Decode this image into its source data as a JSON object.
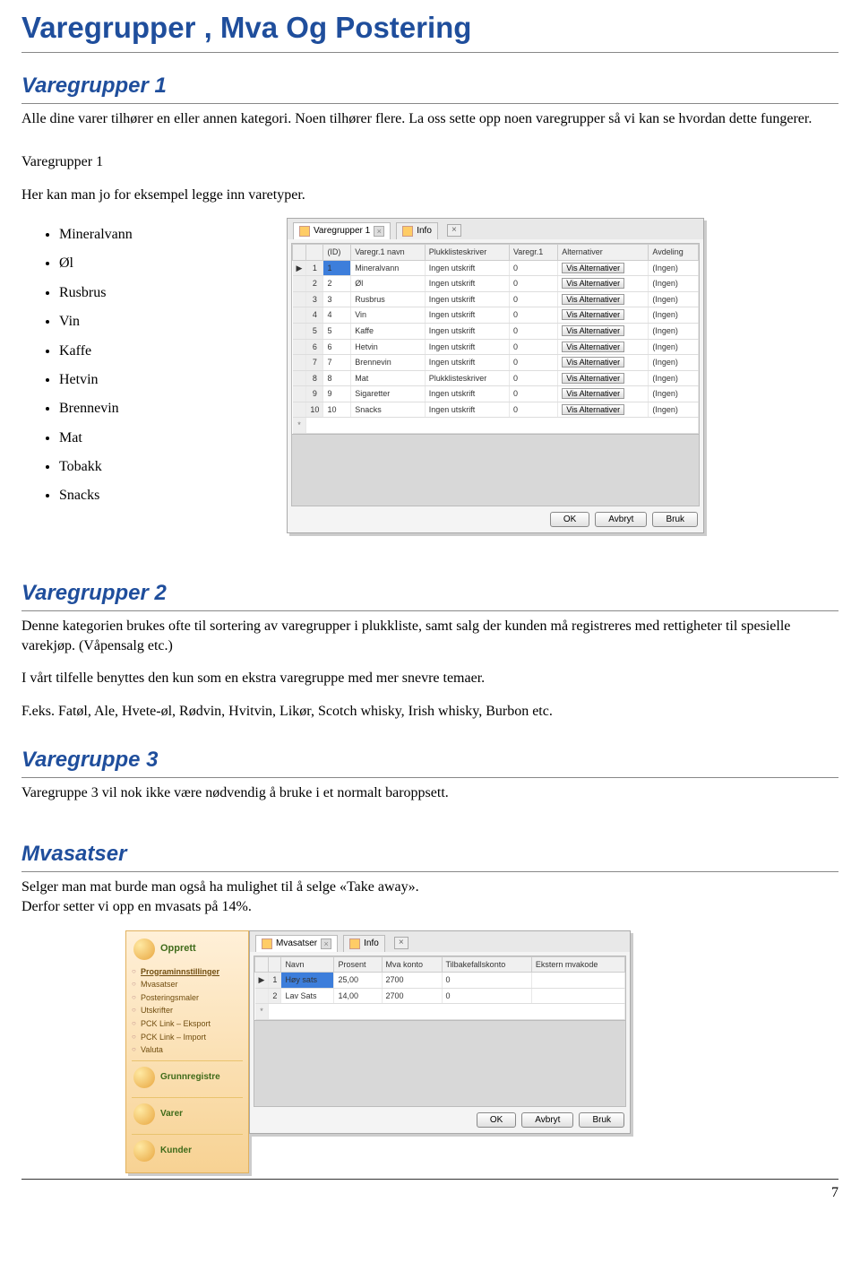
{
  "page_title": "Varegrupper , Mva Og Postering",
  "varegrupper1": {
    "heading": "Varegrupper 1",
    "intro": "Alle dine varer tilhører en eller annen kategori. Noen tilhører flere. La oss sette opp noen varegrupper så vi kan se hvordan dette fungerer.",
    "sub_label": "Varegrupper 1",
    "sub_text": "Her kan man jo for eksempel legge inn varetyper.",
    "bullets": [
      "Mineralvann",
      "Øl",
      "Rusbrus",
      "Vin",
      "Kaffe",
      "Hetvin",
      "Brennevin",
      "Mat",
      "Tobakk",
      "Snacks"
    ],
    "window": {
      "tab_active": "Varegrupper 1",
      "tab_info": "Info",
      "columns": [
        "(ID)",
        "Varegr.1 navn",
        "Plukklisteskriver",
        "Varegr.1",
        "Alternativer",
        "Avdeling"
      ],
      "alt_button": "Vis Alternativer",
      "avdeling_val": "(Ingen)",
      "plukk_val": "Ingen utskrift",
      "plukk_val2": "Plukklisteskriver",
      "rows": [
        {
          "id": "1",
          "id2": "1",
          "navn": "Mineralvann",
          "plukk": "Ingen utskrift",
          "v": "0"
        },
        {
          "id": "2",
          "id2": "2",
          "navn": "Øl",
          "plukk": "Ingen utskrift",
          "v": "0"
        },
        {
          "id": "3",
          "id2": "3",
          "navn": "Rusbrus",
          "plukk": "Ingen utskrift",
          "v": "0"
        },
        {
          "id": "4",
          "id2": "4",
          "navn": "Vin",
          "plukk": "Ingen utskrift",
          "v": "0"
        },
        {
          "id": "5",
          "id2": "5",
          "navn": "Kaffe",
          "plukk": "Ingen utskrift",
          "v": "0"
        },
        {
          "id": "6",
          "id2": "6",
          "navn": "Hetvin",
          "plukk": "Ingen utskrift",
          "v": "0"
        },
        {
          "id": "7",
          "id2": "7",
          "navn": "Brennevin",
          "plukk": "Ingen utskrift",
          "v": "0"
        },
        {
          "id": "8",
          "id2": "8",
          "navn": "Mat",
          "plukk": "Plukklisteskriver",
          "v": "0"
        },
        {
          "id": "9",
          "id2": "9",
          "navn": "Sigaretter",
          "plukk": "Ingen utskrift",
          "v": "0"
        },
        {
          "id": "10",
          "id2": "10",
          "navn": "Snacks",
          "plukk": "Ingen utskrift",
          "v": "0"
        }
      ],
      "btn_ok": "OK",
      "btn_cancel": "Avbryt",
      "btn_apply": "Bruk"
    }
  },
  "varegrupper2": {
    "heading": "Varegrupper 2",
    "p1": "Denne kategorien brukes ofte til sortering av varegrupper i plukkliste, samt salg der kunden må registreres med rettigheter til spesielle varekjøp. (Våpensalg etc.)",
    "p2": "I vårt tilfelle benyttes den kun som en ekstra varegruppe med mer snevre temaer.",
    "p3": "F.eks. Fatøl, Ale, Hvete-øl, Rødvin, Hvitvin, Likør, Scotch whisky, Irish whisky, Burbon etc."
  },
  "varegruppe3": {
    "heading": "Varegruppe 3",
    "p": "Varegruppe 3 vil nok ikke være nødvendig å bruke i et normalt baroppsett."
  },
  "mvasatser": {
    "heading": "Mvasatser",
    "p1": "Selger man mat burde man også ha mulighet til å selge «Take away».",
    "p2": "Derfor setter vi opp en mvasats på 14%.",
    "side": {
      "head": "Opprett",
      "links": [
        "Programinnstillinger",
        "Mvasatser",
        "Posteringsmaler",
        "Utskrifter",
        "PCK Link – Eksport",
        "PCK Link – Import",
        "Valuta"
      ],
      "rows": [
        "Grunnregistre",
        "Varer",
        "Kunder"
      ]
    },
    "window": {
      "tab_active": "Mvasatser",
      "tab_info": "Info",
      "columns": [
        "Navn",
        "Prosent",
        "Mva konto",
        "Tilbakefallskonto",
        "Ekstern mvakode"
      ],
      "rows": [
        {
          "n": "1",
          "navn": "Høy sats",
          "p": "25,00",
          "k": "2700",
          "t": "0",
          "e": ""
        },
        {
          "n": "2",
          "navn": "Lav Sats",
          "p": "14,00",
          "k": "2700",
          "t": "0",
          "e": ""
        }
      ],
      "btn_ok": "OK",
      "btn_cancel": "Avbryt",
      "btn_apply": "Bruk"
    }
  },
  "page_number": "7"
}
